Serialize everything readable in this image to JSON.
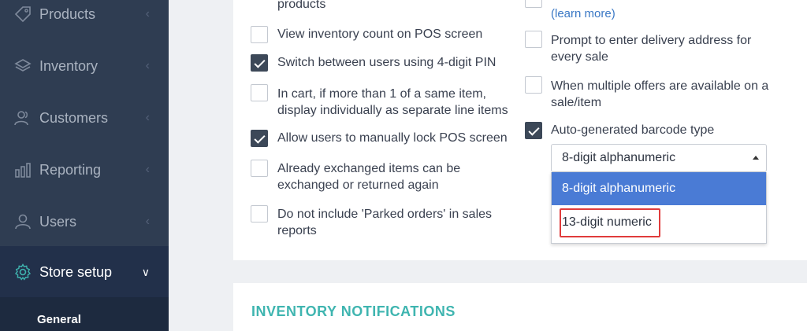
{
  "sidebar": {
    "items": [
      {
        "label": "Products",
        "icon": "tag-icon"
      },
      {
        "label": "Inventory",
        "icon": "layers-icon"
      },
      {
        "label": "Customers",
        "icon": "customers-icon"
      },
      {
        "label": "Reporting",
        "icon": "bar-chart-icon"
      },
      {
        "label": "Users",
        "icon": "user-icon"
      },
      {
        "label": "Store setup",
        "icon": "gear-icon"
      }
    ],
    "submenu": {
      "label": "General"
    }
  },
  "options_left": [
    {
      "text": "products",
      "checked": null
    },
    {
      "text": "View inventory count on POS screen",
      "checked": false
    },
    {
      "text": "Switch between users using 4-digit PIN",
      "checked": true
    },
    {
      "text": "In cart, if more than 1 of a same item, display individually as separate line items",
      "checked": false
    },
    {
      "text": "Allow users to manually lock POS screen",
      "checked": true
    },
    {
      "text": "Already exchanged items can be exchanged or returned again",
      "checked": false
    },
    {
      "text": "Do not include 'Parked orders' in sales reports",
      "checked": false
    }
  ],
  "options_right": [
    {
      "link": "(learn more)"
    },
    {
      "text": "Prompt to enter delivery address for every sale",
      "checked": false
    },
    {
      "text": "When multiple offers are available on a sale/item",
      "checked": false
    },
    {
      "text": "Auto-generated barcode type",
      "checked": true
    }
  ],
  "barcode_select": {
    "value": "8-digit alphanumeric",
    "options": [
      "8-digit alphanumeric",
      "13-digit numeric"
    ]
  },
  "section2": {
    "title": "INVENTORY NOTIFICATIONS"
  },
  "colors": {
    "sidebar": "#2f3d52",
    "accent": "#3fb5b0",
    "highlight": "#4a7bd5",
    "annotation": "#e03c3c"
  }
}
